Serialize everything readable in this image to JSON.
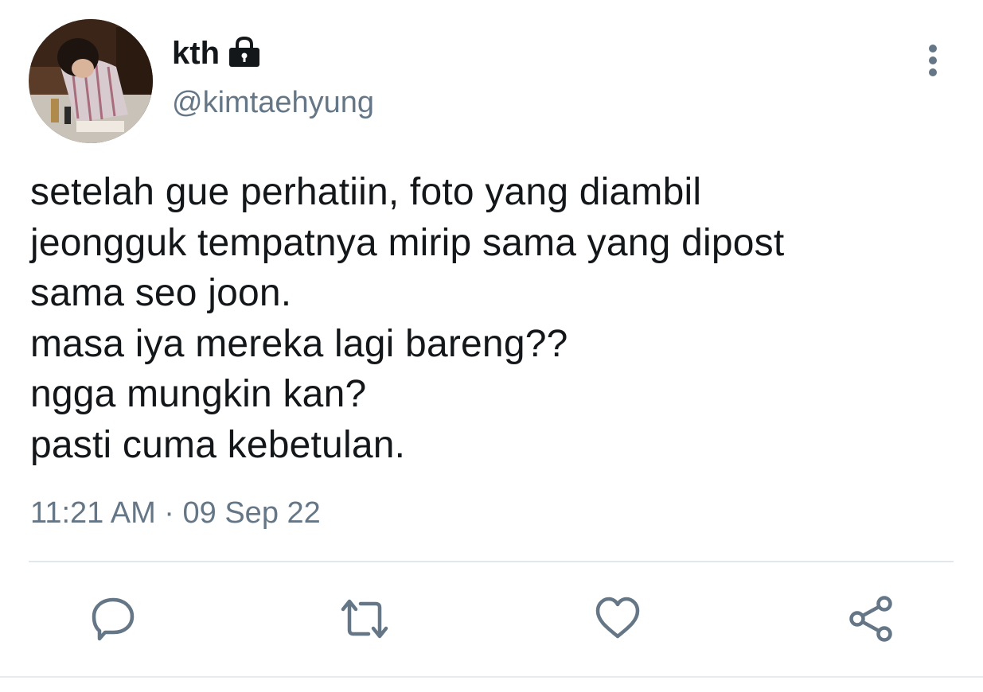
{
  "tweet": {
    "display_name": "kth",
    "handle": "@kimtaehyung",
    "protected_icon": "lock-icon",
    "text_lines": [
      "setelah gue perhatiin, foto yang diambil",
      "jeongguk tempatnya mirip sama yang dipost",
      "sama seo joon.",
      "masa iya mereka lagi bareng??",
      "ngga mungkin kan?",
      "pasti cuma kebetulan."
    ],
    "time": "11:21 AM",
    "separator": "·",
    "date": "09 Sep 22"
  },
  "actions": {
    "reply_icon": "reply-icon",
    "retweet_icon": "retweet-icon",
    "like_icon": "like-icon",
    "share_icon": "share-icon"
  },
  "colors": {
    "text": "#14171a",
    "secondary": "#657786",
    "divider": "#e1e8ed"
  }
}
